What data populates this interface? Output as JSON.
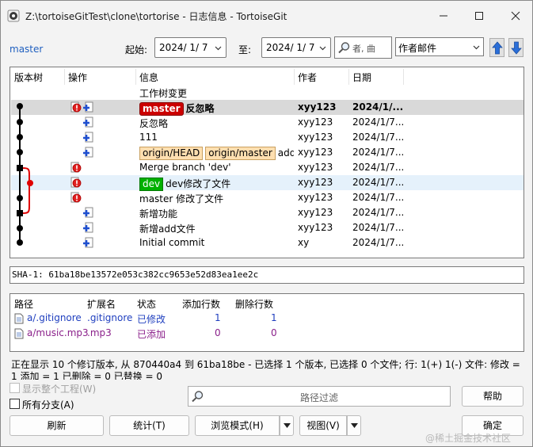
{
  "window": {
    "title": "Z:\\tortoiseGitTest\\clone\\tortorise - 日志信息 - TortoiseGit"
  },
  "filter": {
    "branch": "master",
    "from_label": "起始:",
    "from_date": "2024/ 1/ 7",
    "to_label": "至:",
    "to_date": "2024/ 1/ 7",
    "search_placeholder": "者, 曲",
    "search_field": "作者邮件"
  },
  "log": {
    "columns": [
      "版本树",
      "操作",
      "信息",
      "作者",
      "日期"
    ],
    "rows": [
      {
        "message": "工作树变更",
        "author": "",
        "date": "",
        "refs": []
      },
      {
        "message": "反忽略",
        "author": "xyy123",
        "date": "2024/1/...",
        "refs": [
          {
            "label": "master",
            "style": "head"
          }
        ],
        "selected": true
      },
      {
        "message": "反忽略",
        "author": "xyy123",
        "date": "2024/1/7...",
        "refs": []
      },
      {
        "message": "111",
        "author": "xyy123",
        "date": "2024/1/7...",
        "refs": []
      },
      {
        "message": "add ig...",
        "author": "xyy123",
        "date": "2024/1/7...",
        "refs": [
          {
            "label": "origin/HEAD",
            "style": "remote"
          },
          {
            "label": "origin/master",
            "style": "remote"
          }
        ]
      },
      {
        "message": "Merge branch 'dev'",
        "author": "xyy123",
        "date": "2024/1/7...",
        "refs": []
      },
      {
        "message": "dev修改了文件",
        "author": "xyy123",
        "date": "2024/1/7...",
        "refs": [
          {
            "label": "dev",
            "style": "branch"
          }
        ],
        "hover": true
      },
      {
        "message": "master 修改了文件",
        "author": "xyy123",
        "date": "2024/1/7...",
        "refs": []
      },
      {
        "message": "新增功能",
        "author": "xyy123",
        "date": "2024/1/7...",
        "refs": []
      },
      {
        "message": "新增add文件",
        "author": "xyy123",
        "date": "2024/1/7...",
        "refs": []
      },
      {
        "message": "Initial commit",
        "author": "xy",
        "date": "2024/1/7...",
        "refs": []
      }
    ]
  },
  "sha": "SHA-1: 61ba18be13572e053c382cc9653e52d83ea1ee2c",
  "files": {
    "columns": [
      "路径",
      "扩展名",
      "状态",
      "添加行数",
      "删除行数"
    ],
    "rows": [
      {
        "path": "a/.gitignore",
        "ext": ".gitignore",
        "status": "已修改",
        "added": "1",
        "deleted": "1",
        "color": "#1f3fbf"
      },
      {
        "path": "a/music.mp3",
        "ext": ".mp3",
        "status": "已添加",
        "added": "0",
        "deleted": "0",
        "color": "#8a1f8a"
      }
    ]
  },
  "status_text": "正在显示 10 个修订版本, 从 870440a4 到 61ba18be - 已选择 1 个版本, 已选择 0 个文件; 行: 1(+) 1(-) 文件: 修改 = 1 添加 = 1 已删除 = 0 已替换 = 0",
  "options": {
    "show_whole_project": "显示整个工程(W)",
    "all_branches": "所有分支(A)",
    "path_filter_placeholder": "路径过滤"
  },
  "buttons": {
    "help": "帮助",
    "refresh": "刷新",
    "stats": "统计(T)",
    "view_mode": "浏览模式(H)",
    "view": "视图(V)",
    "ok": "确定"
  },
  "watermark": "@稀土掘金技术社区",
  "colors": {
    "head_tag": "#cc0000",
    "remote_tag": "#ffdfb0",
    "branch_tag": "#00b000",
    "link": "#1f5fbf"
  }
}
